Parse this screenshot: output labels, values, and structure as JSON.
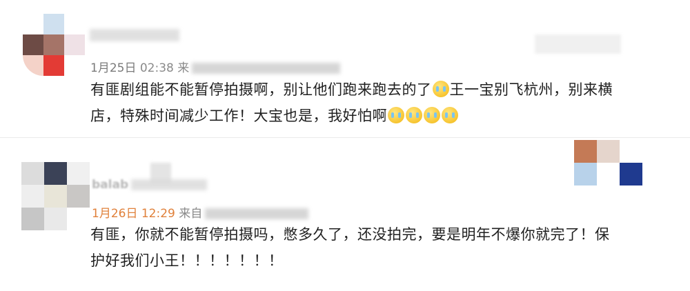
{
  "comments": [
    {
      "time_date": "1月25日",
      "time_clock": "02:38",
      "source_prefix": "来",
      "text_line1": "有匪剧组能不能暂停拍摄啊，别让他们跑来跑去的了",
      "text_line1b": "王一宝别飞杭州，别来横",
      "text_line2": "店，特殊时间减少工作！大宝也是，我好怕啊",
      "emoji_name": "crying-emoji"
    },
    {
      "name_visible": "balab",
      "time_date": "1月26日",
      "time_clock": "12:29",
      "source_prefix": "来自",
      "text_line1": "有匪，你就不能暂停拍摄吗，憋多久了，还没拍完，要是明年不爆你就完了！保",
      "text_line2": "护好我们小王！！！！！！！"
    }
  ],
  "colors": {
    "date_accent": "#e0803a",
    "meta_gray": "#8a8a8a",
    "text": "#1f1f1f",
    "divider": "#eaeaea"
  }
}
